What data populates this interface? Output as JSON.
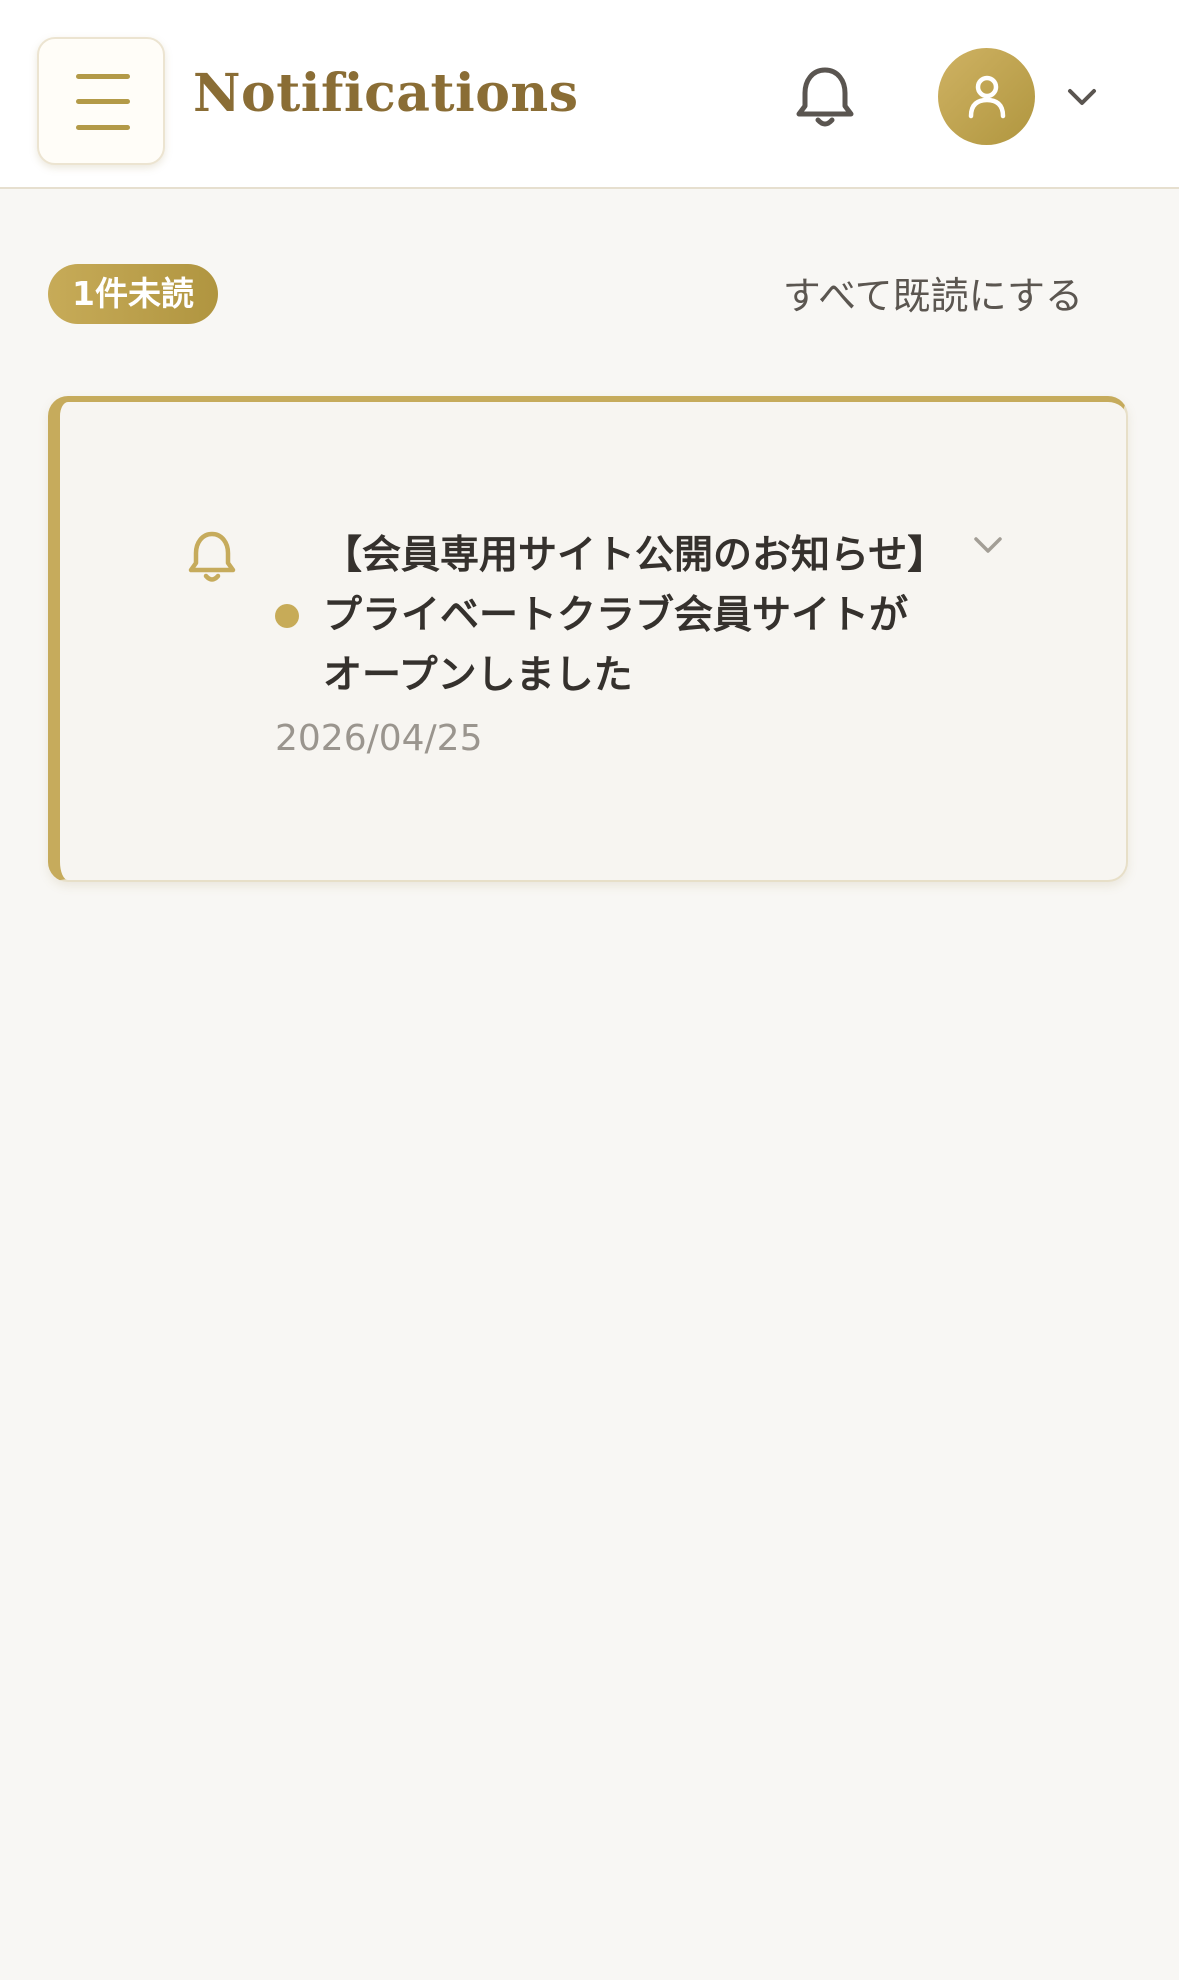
{
  "header": {
    "title": "Notifications"
  },
  "toolbar": {
    "unread_badge": "1件未読",
    "mark_all_read": "すべて既読にする"
  },
  "notifications": [
    {
      "title": "【会員専用サイト公開のお知らせ】プライベートクラブ会員サイトがオープンしました",
      "date": "2026/04/25",
      "unread": true
    }
  ],
  "icons": {
    "menu": "hamburger-icon",
    "bell": "bell-icon",
    "avatar": "user-icon",
    "expand": "chevron-down-icon"
  },
  "colors": {
    "accent": "#c6ab5c",
    "title": "#8a6d35",
    "background": "#f8f7f4"
  }
}
